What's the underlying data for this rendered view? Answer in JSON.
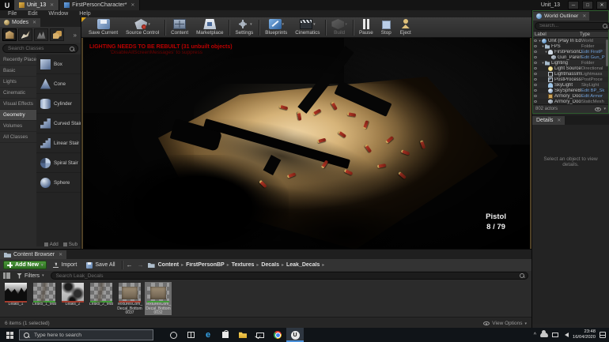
{
  "window": {
    "logo_letter": "U",
    "level_tab": "Unit_13",
    "asset_tab": "FirstPersonCharacter*",
    "title": "Unit_13",
    "minimize_glyph": "─",
    "maximize_glyph": "□",
    "close_glyph": "✕",
    "tab_close_glyph": "✕"
  },
  "menu": {
    "items": [
      "File",
      "Edit",
      "Window",
      "Help"
    ]
  },
  "modes_panel": {
    "tab_label": "Modes",
    "search_placeholder": "Search Classes",
    "mode_icons": [
      "place-mode-icon",
      "paint-mode-icon",
      "landscape-mode-icon",
      "foliage-mode-icon"
    ],
    "overflow_glyph": "»",
    "categories": [
      "Recently Placed",
      "Basic",
      "Lights",
      "Cinematic",
      "Visual Effects",
      "Geometry",
      "Volumes",
      "All Classes"
    ],
    "selected_category": "Geometry",
    "items": [
      {
        "label": "Box",
        "icon": "box"
      },
      {
        "label": "Cone",
        "icon": "cone"
      },
      {
        "label": "Cylinder",
        "icon": "cylinder"
      },
      {
        "label": "Curved Stair",
        "icon": "curved-stair"
      },
      {
        "label": "Linear Stair",
        "icon": "linear-stair"
      },
      {
        "label": "Spiral Stair",
        "icon": "spiral-stair"
      },
      {
        "label": "Sphere",
        "icon": "sphere"
      }
    ],
    "footer_add": "Add",
    "footer_sub": "Sub"
  },
  "toolbar": {
    "dropdown_glyph": "▾",
    "buttons": [
      {
        "label": "Save Current",
        "icon": "save",
        "dropdown": false,
        "enabled": true,
        "sep_before": false
      },
      {
        "label": "Source Control",
        "icon": "source-control",
        "dropdown": true,
        "enabled": true,
        "sep_before": false
      },
      {
        "label": "Content",
        "icon": "content",
        "dropdown": false,
        "enabled": true,
        "sep_before": true
      },
      {
        "label": "Marketplace",
        "icon": "marketplace",
        "dropdown": false,
        "enabled": true,
        "sep_before": false
      },
      {
        "label": "Settings",
        "icon": "settings",
        "dropdown": true,
        "enabled": true,
        "sep_before": true
      },
      {
        "label": "Blueprints",
        "icon": "blueprints",
        "dropdown": true,
        "enabled": true,
        "sep_before": true
      },
      {
        "label": "Cinematics",
        "icon": "cinematics",
        "dropdown": true,
        "enabled": true,
        "sep_before": false
      },
      {
        "label": "Build",
        "icon": "build",
        "dropdown": true,
        "enabled": false,
        "sep_before": true
      },
      {
        "label": "Pause",
        "icon": "pause",
        "dropdown": false,
        "enabled": true,
        "sep_before": true
      },
      {
        "label": "Stop",
        "icon": "stop",
        "dropdown": false,
        "enabled": true,
        "sep_before": false
      },
      {
        "label": "Eject",
        "icon": "eject",
        "dropdown": false,
        "enabled": true,
        "sep_before": false
      }
    ]
  },
  "viewport": {
    "warning_line1": "LIGHTING NEEDS TO BE REBUILT (31 unbuilt objects)",
    "warning_line2": "'DisableAllScreenMessages' to suppress",
    "hud_weapon": "Pistol",
    "hud_ammo": "8 / 79"
  },
  "world_outliner": {
    "tab_label": "World Outliner",
    "search_placeholder": "Search...",
    "label_column": "Label",
    "type_column": "Type",
    "rows": [
      {
        "label": "Unit (Play In Editor)",
        "type": "World",
        "indent": 0,
        "expander": "▾",
        "icon": "world",
        "link": false
      },
      {
        "label": "FPS",
        "type": "Folder",
        "indent": 1,
        "expander": "▾",
        "icon": "folder",
        "link": false
      },
      {
        "label": "FirstPersonCha",
        "type": "Edit FirstP",
        "indent": 2,
        "expander": "▾",
        "icon": "pawn",
        "link": true
      },
      {
        "label": "Gun_Parent_(",
        "type": "Edit Gun_P",
        "indent": 3,
        "expander": "",
        "icon": "actor",
        "link": true
      },
      {
        "label": "Lighting",
        "type": "Folder",
        "indent": 1,
        "expander": "▾",
        "icon": "folder",
        "link": false
      },
      {
        "label": "Light Source",
        "type": "Directional",
        "indent": 2,
        "expander": "",
        "icon": "light",
        "link": false
      },
      {
        "label": "LightmassImpo",
        "type": "Lightmass",
        "indent": 2,
        "expander": "",
        "icon": "lightmass",
        "link": false
      },
      {
        "label": "PostProcessVo",
        "type": "PostProce",
        "indent": 2,
        "expander": "",
        "icon": "postprocess",
        "link": false
      },
      {
        "label": "SkyLight",
        "type": "SkyLight",
        "indent": 2,
        "expander": "",
        "icon": "skylight",
        "link": false
      },
      {
        "label": "SkySphereBlue",
        "type": "Edit BP_Sk",
        "indent": 2,
        "expander": "",
        "icon": "sphere",
        "link": true
      },
      {
        "label": "Armory_Door",
        "type": "Edit Armor",
        "indent": 2,
        "expander": "",
        "icon": "door",
        "link": true
      },
      {
        "label": "Armory_Door_Upc",
        "type": "StaticMesh",
        "indent": 2,
        "expander": "",
        "icon": "mesh",
        "link": false
      }
    ],
    "footer": "802 actors",
    "view_options": "View Options"
  },
  "details_panel": {
    "tab_label": "Details",
    "empty_text": "Select an object to view details."
  },
  "content_browser": {
    "tab_label": "Content Browser",
    "add_new_label": "Add New",
    "import_label": "Import",
    "save_all_label": "Save All",
    "back_glyph": "←",
    "forward_glyph": "→",
    "breadcrumbs": [
      "Content",
      "FirstPersonBP",
      "Textures",
      "Decals",
      "Leak_Decals"
    ],
    "crumb_glyph": "▸",
    "filters_label": "Filters",
    "search_placeholder": "Search Leak_Decals",
    "assets": [
      {
        "name": "Leaks_1",
        "kind": "texture",
        "thumb": "leak1",
        "selected": false
      },
      {
        "name": "Leaks_1_Mat",
        "kind": "material",
        "thumb": "mat",
        "selected": false
      },
      {
        "name": "Leaks_2",
        "kind": "texture",
        "thumb": "leak2",
        "selected": false
      },
      {
        "name": "Leaks_2_Mat",
        "kind": "material",
        "thumb": "mat",
        "selected": false
      },
      {
        "name": "TexturesCom_Decal_Bottom0037",
        "kind": "texture",
        "thumb": "decal",
        "selected": false
      },
      {
        "name": "TexturesCom_Decal_Bottom0032",
        "kind": "material",
        "thumb": "decal",
        "selected": true
      }
    ],
    "status": "6 items (1 selected)",
    "view_options": "View Options"
  },
  "taskbar": {
    "search_placeholder": "Type here to search",
    "icons": [
      "cortana",
      "task-view",
      "edge",
      "store",
      "file-explorer",
      "mail",
      "chrome",
      "unreal"
    ],
    "active_icon": "unreal",
    "unreal_letter": "U",
    "edge_letter": "e",
    "tray_chevron": "^",
    "time": "23:48",
    "date": "16/04/2020"
  },
  "colors": {
    "accent_green": "#3f8e2f",
    "link_blue": "#6f9fd8",
    "warning_red": "#bb0000",
    "texture_bar": "#a33c2e",
    "material_bar": "#3f9b35"
  }
}
